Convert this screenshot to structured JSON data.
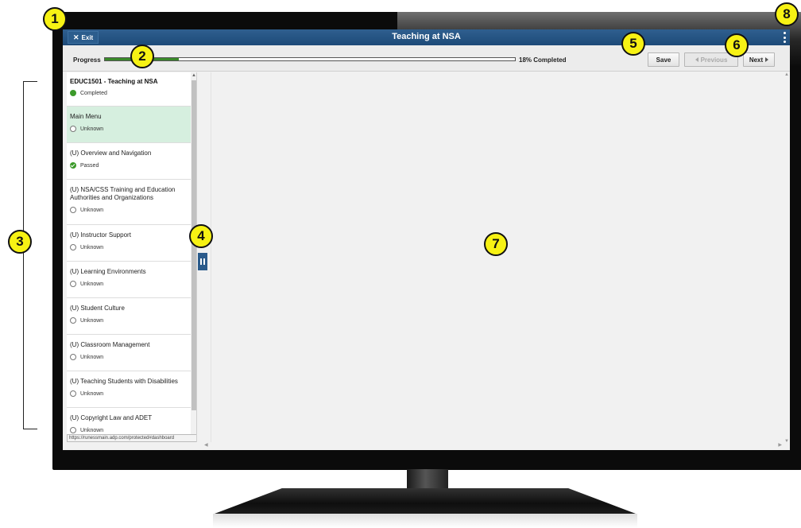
{
  "window": {
    "title": "Teaching at NSA",
    "exit_label": "Exit",
    "exit_icon": "close-icon",
    "menu_icon": "kebab-menu-icon"
  },
  "progress": {
    "label": "Progress",
    "percent": 18,
    "text": "18% Completed"
  },
  "toolbar": {
    "save_label": "Save",
    "previous_label": "Previous",
    "next_label": "Next"
  },
  "sidebar": {
    "course_title": "EDUC1501 - Teaching at NSA",
    "course_status": "Completed",
    "items": [
      {
        "label": "Main Menu",
        "status": "Unknown",
        "active": true
      },
      {
        "label": "(U) Overview and Navigation",
        "status": "Passed"
      },
      {
        "label": "(U) NSA/CSS Training and Education Authorities and Organizations",
        "status": "Unknown"
      },
      {
        "label": "(U) Instructor Support",
        "status": "Unknown"
      },
      {
        "label": "(U) Learning Environments",
        "status": "Unknown"
      },
      {
        "label": "(U) Student Culture",
        "status": "Unknown"
      },
      {
        "label": "(U) Classroom Management",
        "status": "Unknown"
      },
      {
        "label": "(U) Teaching Students with Disabilities",
        "status": "Unknown"
      },
      {
        "label": "(U) Copyright Law and ADET",
        "status": "Unknown"
      }
    ],
    "status_url": "https://runessmain.adp.com/protected#dashboard"
  },
  "callouts": [
    "1",
    "2",
    "3",
    "4",
    "5",
    "6",
    "7",
    "8"
  ],
  "colors": {
    "title_bar": "#1d4a78",
    "progress_fill": "#3a8a2a",
    "active_item": "#d6efdf",
    "callout": "#f7f214"
  }
}
